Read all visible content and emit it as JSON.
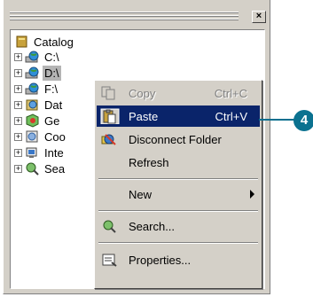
{
  "tree": {
    "root_label": "Catalog",
    "items": [
      {
        "label": "C:\\"
      },
      {
        "label": "D:\\"
      },
      {
        "label": "F:\\"
      },
      {
        "label": "Dat"
      },
      {
        "label": "Ge"
      },
      {
        "label": "Coo"
      },
      {
        "label": "Inte"
      },
      {
        "label": "Sea"
      }
    ],
    "expander_symbol": "+"
  },
  "close_symbol": "×",
  "context_menu": {
    "copy": {
      "label": "Copy",
      "shortcut": "Ctrl+C"
    },
    "paste": {
      "label": "Paste",
      "shortcut": "Ctrl+V"
    },
    "disconnect": {
      "label": "Disconnect Folder"
    },
    "refresh": {
      "label": "Refresh"
    },
    "new": {
      "label": "New"
    },
    "search": {
      "label": "Search..."
    },
    "properties": {
      "label": "Properties..."
    }
  },
  "callout": {
    "number": "4"
  },
  "colors": {
    "highlight": "#0a246a",
    "callout": "#0b7290",
    "panel": "#d4d0c8"
  }
}
